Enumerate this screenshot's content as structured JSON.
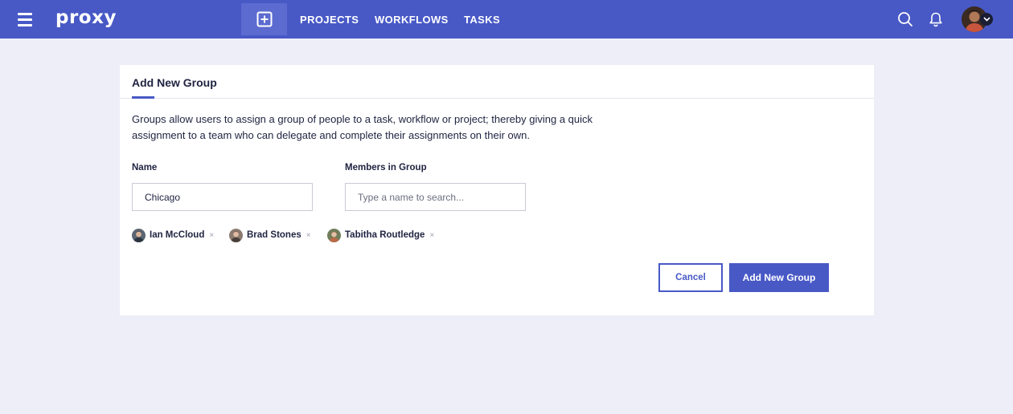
{
  "app": {
    "logo": "proxy"
  },
  "nav": {
    "items": [
      {
        "label": "PROJECTS"
      },
      {
        "label": "WORKFLOWS"
      },
      {
        "label": "TASKS"
      }
    ],
    "new_icon": "plus-square-icon"
  },
  "header_icons": {
    "search": "search-icon",
    "notifications": "bell-icon",
    "menu": "hamburger-icon"
  },
  "colors": {
    "brand": "#4859c6",
    "background": "#eeeef8",
    "text": "#1f2340"
  },
  "form": {
    "title": "Add New Group",
    "description": "Groups allow users to assign a group of people to a task, workflow or project; thereby giving a quick assignment to a team who can delegate and complete their assignments on their own.",
    "name_label": "Name",
    "name_value": "Chicago",
    "members_label": "Members in Group",
    "members_placeholder": "Type a name to search...",
    "members": [
      {
        "name": "Ian McCloud",
        "remove": "×"
      },
      {
        "name": "Brad Stones",
        "remove": "×"
      },
      {
        "name": "Tabitha Routledge",
        "remove": "×"
      }
    ],
    "cancel_label": "Cancel",
    "submit_label": "Add New Group"
  }
}
